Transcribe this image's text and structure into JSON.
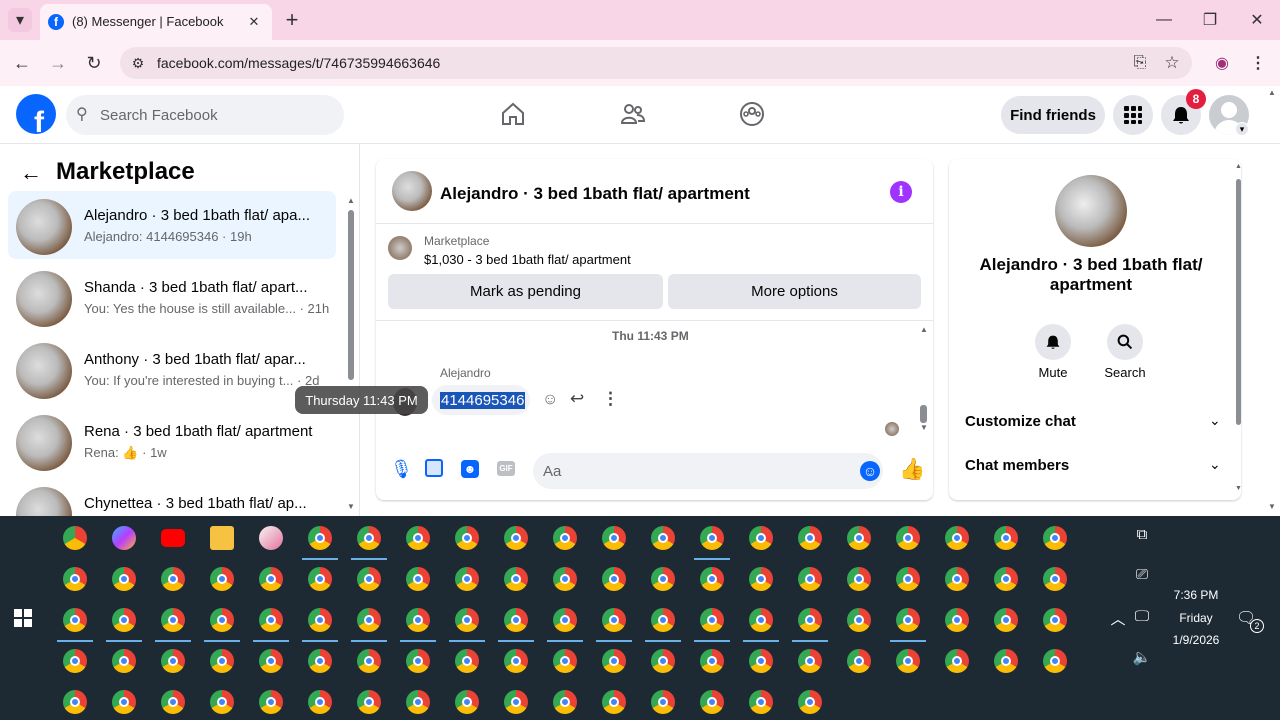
{
  "browser": {
    "tab_title": "(8) Messenger | Facebook",
    "url": "facebook.com/messages/t/746735994663646",
    "new_tab": "+",
    "close_tab": "✕"
  },
  "header": {
    "search_placeholder": "Search Facebook",
    "find_friends": "Find friends",
    "notification_count": "8"
  },
  "sidebar": {
    "title": "Marketplace",
    "conversations": [
      {
        "name": "Alejandro · 3 bed 1bath flat/ apa...",
        "preview": "Alejandro: 4144695346 · 19h",
        "selected": true
      },
      {
        "name": "Shanda · 3 bed 1bath flat/ apart...",
        "preview": "You: Yes the house is still available... · 21h"
      },
      {
        "name": "Anthony · 3 bed 1bath flat/ apar...",
        "preview": "You: If you're interested in buying t... · 2d"
      },
      {
        "name": "Rena · 3 bed 1bath flat/ apartment",
        "preview_prefix": "Rena:",
        "preview_suffix": "· 1w"
      },
      {
        "name": "Chynettea · 3 bed 1bath flat/ ap..."
      }
    ]
  },
  "chat": {
    "title": "Alejandro · 3 bed 1bath flat/ apartment",
    "listing_source": "Marketplace",
    "listing_text": "$1,030 - 3 bed 1bath flat/ apartment",
    "mark_pending": "Mark as pending",
    "more_options": "More options",
    "timestamp": "Thu 11:43 PM",
    "sender": "Alejandro",
    "message": "4144695346",
    "tooltip": "Thursday 11:43 PM",
    "composer_placeholder": "Aa",
    "gif_label": "GIF"
  },
  "profile": {
    "name": "Alejandro · 3 bed 1bath flat/ apartment",
    "mute": "Mute",
    "search": "Search",
    "customize_chat": "Customize chat",
    "chat_members": "Chat members"
  },
  "taskbar": {
    "time": "7:36 PM",
    "day": "Friday",
    "date": "1/9/2026",
    "notif_count": "2"
  },
  "colors": {
    "fb_blue": "#0866ff",
    "messenger_purple": "#a033ff",
    "tab_bar": "#f8d6e8",
    "taskbar": "#1e2a33",
    "notification_red": "#e41e3f"
  }
}
